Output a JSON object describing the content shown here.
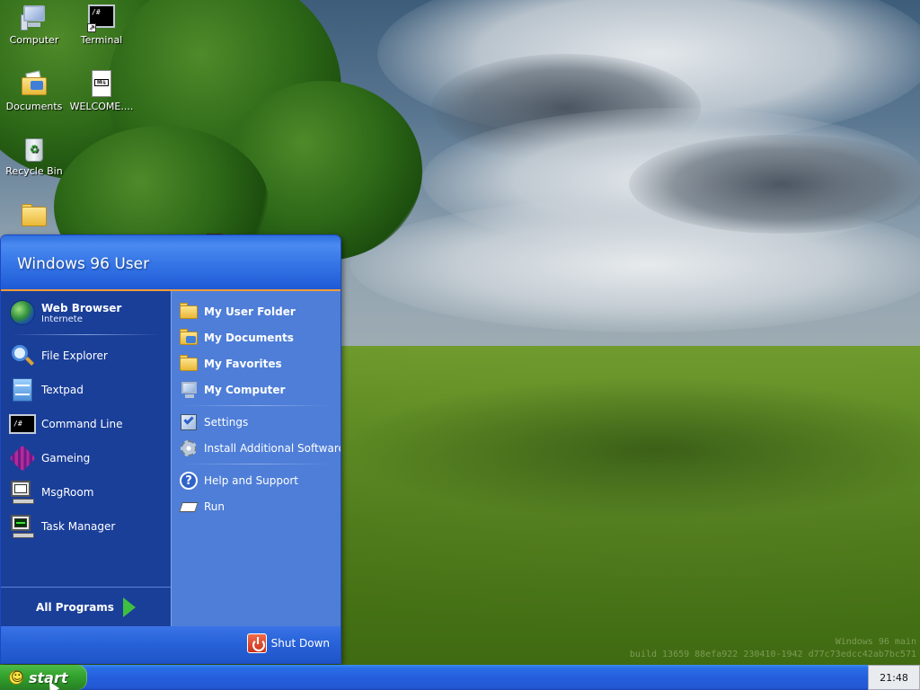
{
  "desktop": {
    "icons": [
      {
        "label": "Computer",
        "icon": "computer-icon"
      },
      {
        "label": "Terminal",
        "icon": "terminal-icon"
      },
      {
        "label": "Documents",
        "icon": "documents-icon"
      },
      {
        "label": "WELCOME....",
        "icon": "markdown-file-icon"
      },
      {
        "label": "Recycle Bin",
        "icon": "recycle-bin-icon"
      },
      {
        "label": "",
        "icon": "folder-icon"
      }
    ],
    "build_info": {
      "line1": "Windows 96 main",
      "line2": "build 13659 88efa922 230410-1942 d77c73edcc42ab7bc571"
    }
  },
  "start_menu": {
    "user_name": "Windows 96 User",
    "pinned": {
      "title": "Web Browser",
      "subtitle": "Internete",
      "icon": "globe-icon"
    },
    "recent": [
      {
        "label": "File Explorer",
        "icon": "magnifier-icon"
      },
      {
        "label": "Textpad",
        "icon": "notepad-icon"
      },
      {
        "label": "Command Line",
        "icon": "command-line-icon"
      },
      {
        "label": "Gameing",
        "icon": "game-cube-icon"
      },
      {
        "label": "MsgRoom",
        "icon": "chat-computer-icon"
      },
      {
        "label": "Task Manager",
        "icon": "task-manager-icon"
      }
    ],
    "all_programs": "All Programs",
    "places": [
      {
        "label": "My User Folder",
        "icon": "folder-icon"
      },
      {
        "label": "My Documents",
        "icon": "documents-folder-icon"
      },
      {
        "label": "My Favorites",
        "icon": "folder-icon"
      },
      {
        "label": "My Computer",
        "icon": "computer-icon"
      }
    ],
    "system": [
      {
        "label": "Settings",
        "icon": "settings-icon"
      },
      {
        "label": "Install Additional Software",
        "icon": "install-disc-icon"
      }
    ],
    "help": [
      {
        "label": "Help and Support",
        "icon": "help-icon"
      },
      {
        "label": "Run",
        "icon": "run-icon"
      }
    ],
    "shutdown": "Shut Down"
  },
  "taskbar": {
    "start_label": "start",
    "clock": "21:48"
  },
  "colors": {
    "menu_header": "#2f6fe0",
    "menu_left": "#1a3f99",
    "menu_right": "#4e7ed8",
    "taskbar": "#245ede",
    "start_button": "#35a52f"
  }
}
